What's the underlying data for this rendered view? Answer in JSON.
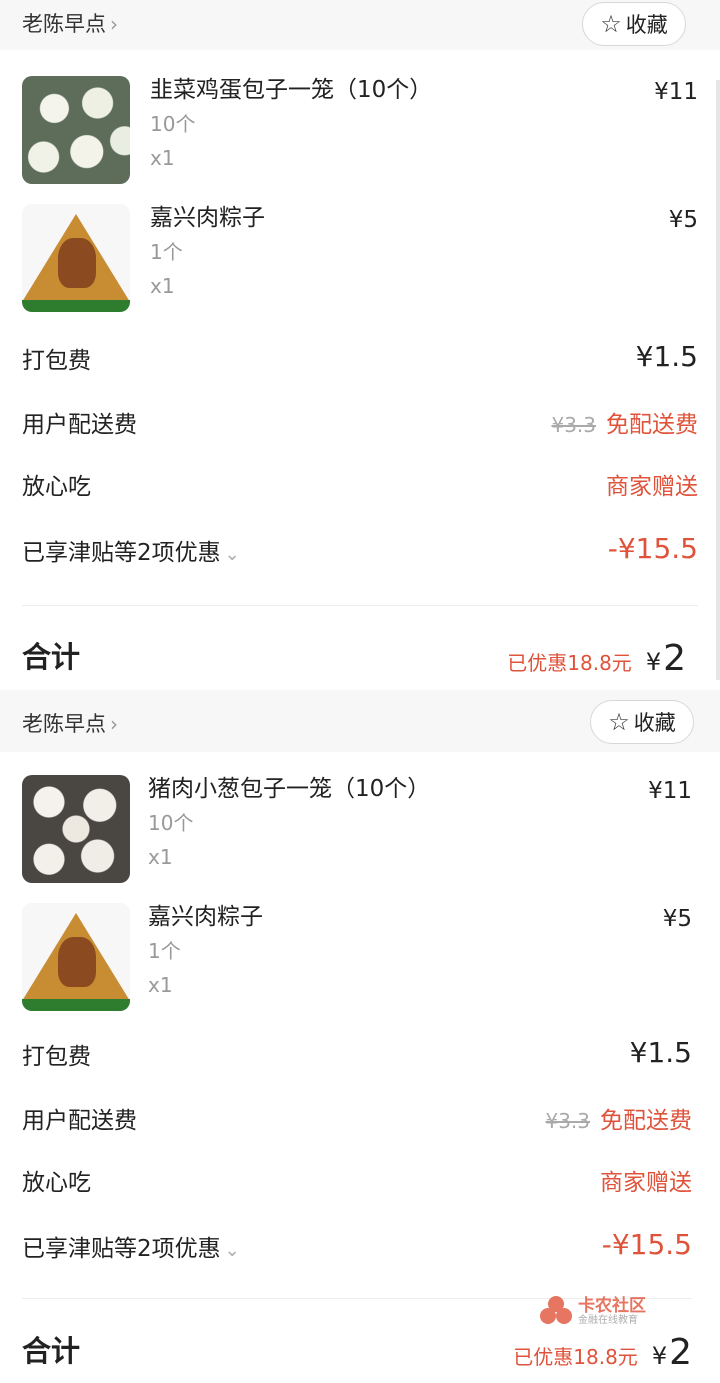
{
  "orders": [
    {
      "store": "老陈早点",
      "favorite_label": "收藏",
      "items": [
        {
          "name": "韭菜鸡蛋包子一笼（10个）",
          "spec": "10个",
          "qty": "x1",
          "price": "¥11",
          "image": "bun"
        },
        {
          "name": "嘉兴肉粽子",
          "spec": "1个",
          "qty": "x1",
          "price": "¥5",
          "image": "zongzi"
        }
      ],
      "packing": {
        "label": "打包费",
        "value": "¥1.5"
      },
      "delivery": {
        "label": "用户配送费",
        "original": "¥3.3",
        "value": "免配送费"
      },
      "assurance": {
        "label": "放心吃",
        "value": "商家赠送"
      },
      "discount": {
        "label": "已享津贴等2项优惠",
        "value": "-¥15.5"
      },
      "total": {
        "label": "合计",
        "saved": "已优惠18.8元",
        "yen": "¥",
        "amount": "2"
      }
    },
    {
      "store": "老陈早点",
      "favorite_label": "收藏",
      "items": [
        {
          "name": "猪肉小葱包子一笼（10个）",
          "spec": "10个",
          "qty": "x1",
          "price": "¥11",
          "image": "bun2"
        },
        {
          "name": "嘉兴肉粽子",
          "spec": "1个",
          "qty": "x1",
          "price": "¥5",
          "image": "zongzi"
        }
      ],
      "packing": {
        "label": "打包费",
        "value": "¥1.5"
      },
      "delivery": {
        "label": "用户配送费",
        "original": "¥3.3",
        "value": "免配送费"
      },
      "assurance": {
        "label": "放心吃",
        "value": "商家赠送"
      },
      "discount": {
        "label": "已享津贴等2项优惠",
        "value": "-¥15.5"
      },
      "total": {
        "label": "合计",
        "saved": "已优惠18.8元",
        "yen": "¥",
        "amount": "2"
      }
    }
  ],
  "watermark": {
    "title": "卡农社区",
    "subtitle": "金融在线教育"
  },
  "colors": {
    "accent_red": "#e0533b"
  }
}
